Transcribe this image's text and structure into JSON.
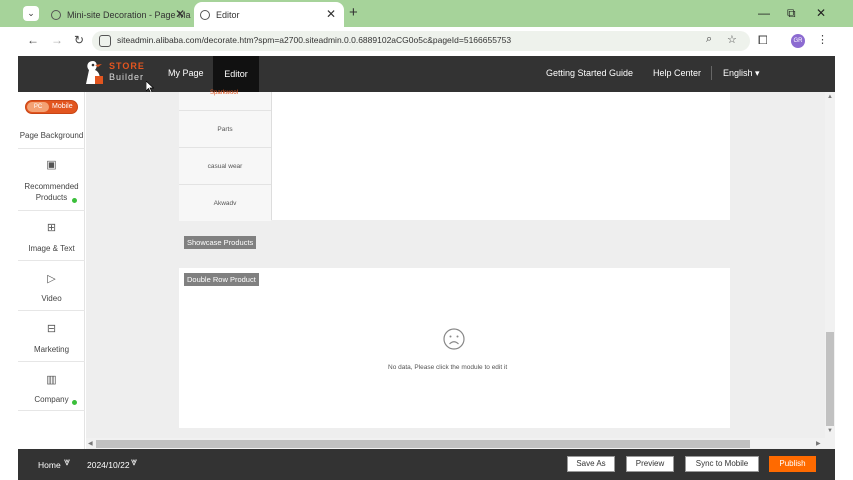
{
  "browser": {
    "tabs": [
      {
        "title": "Mini-site Decoration - Page Ma"
      },
      {
        "title": "Editor"
      }
    ],
    "new_tab_label": "+",
    "url": "siteadmin.alibaba.com/decorate.htm?spm=a2700.siteadmin.0.0.6889102aCG0o5c&pageId=5166655753",
    "profile_initials": "GR"
  },
  "header": {
    "logo_line1": "STORE",
    "logo_line2": "Builder",
    "nav": {
      "my_page": "My Page",
      "editor": "Editor",
      "getting_started": "Getting Started Guide",
      "help_center": "Help Center",
      "language": "English"
    }
  },
  "sidebar": {
    "toggle": {
      "pc": "PC",
      "mobile": "Mobile"
    },
    "items": [
      {
        "label": "Page Background",
        "icon": "none"
      },
      {
        "label": "Recommended Products",
        "icon": "box-icon",
        "badge": true
      },
      {
        "label": "Image & Text",
        "icon": "image-text-icon"
      },
      {
        "label": "Video",
        "icon": "play-icon"
      },
      {
        "label": "Marketing",
        "icon": "marketing-icon"
      },
      {
        "label": "Company",
        "icon": "building-icon",
        "badge": true
      }
    ]
  },
  "canvas": {
    "category_cutoff": "Sparkwool",
    "categories": [
      "Parts",
      "casual wear",
      "Akwadv"
    ],
    "showcase_label": "Showcase Products",
    "double_row_label": "Double Row Product",
    "empty_message": "No data, Please click the module to edit it"
  },
  "footer": {
    "page_select": "Home",
    "date_select": "2024/10/22",
    "save_as": "Save As",
    "preview": "Preview",
    "sync_mobile": "Sync to Mobile",
    "publish": "Publish"
  },
  "colors": {
    "brand_orange": "#ff6a00",
    "header_dark": "#333333",
    "tabstrip_green": "#a6d39a",
    "badge_green": "#3bbf3b"
  }
}
